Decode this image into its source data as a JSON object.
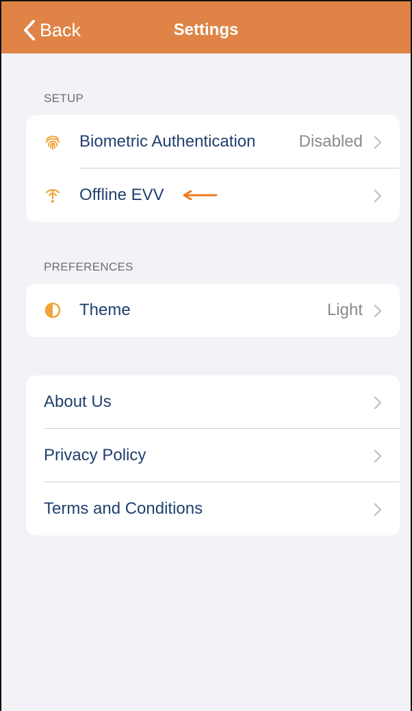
{
  "navbar": {
    "back_label": "Back",
    "title": "Settings",
    "color": "#df8446"
  },
  "setup": {
    "header": "SETUP",
    "items": [
      {
        "label": "Biometric Authentication",
        "value": "Disabled",
        "icon": "fingerprint-icon"
      },
      {
        "label": "Offline EVV",
        "value": "",
        "icon": "offline-signal-icon"
      }
    ]
  },
  "preferences": {
    "header": "PREFERENCES",
    "items": [
      {
        "label": "Theme",
        "value": "Light",
        "icon": "half-circle-theme-icon"
      }
    ]
  },
  "info": {
    "items": [
      {
        "label": "About Us"
      },
      {
        "label": "Privacy Policy"
      },
      {
        "label": "Terms and Conditions"
      }
    ]
  },
  "colors": {
    "accent": "#df8446",
    "icon": "#f0a43a",
    "label": "#1f3f6e",
    "secondary": "#8a8a8e",
    "background": "#f2f2f7"
  }
}
